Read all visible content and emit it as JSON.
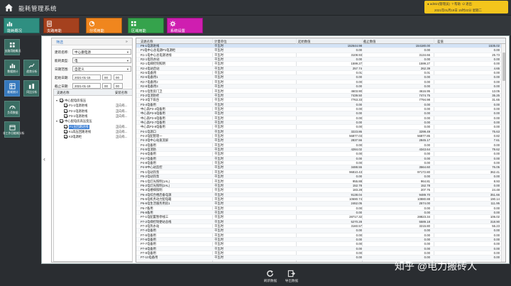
{
  "header": {
    "title": "能耗管理系统",
    "user": "admin(管理员)",
    "help_label": "帮助",
    "exit_label": "退出",
    "datetime": "2021年01月19日 15时22分 星期二"
  },
  "main_tabs": [
    {
      "label": "能耗概况",
      "icon": "chart-icon",
      "color": "#2f8f81"
    },
    {
      "label": "支路用能",
      "icon": "doc-icon",
      "color": "#a5411e"
    },
    {
      "label": "分项用能",
      "icon": "pie-icon",
      "color": "#f0861e"
    },
    {
      "label": "区域用能",
      "icon": "grid-icon",
      "color": "#35a34c"
    },
    {
      "label": "系统设置",
      "icon": "gear-icon",
      "color": "#cf1eb0"
    }
  ],
  "side_nav": [
    {
      "label": "支路用能概况",
      "icon": "grid-icon"
    },
    {
      "label": "数据统计",
      "icon": "bar-icon"
    },
    {
      "label": "趋势分析",
      "icon": "trend-icon"
    },
    {
      "label": "能耗统计",
      "icon": "table-icon"
    },
    {
      "label": "同比分析",
      "icon": "compare-icon"
    },
    {
      "label": "负荷数据",
      "icon": "load-icon"
    },
    {
      "label": "非工作日能耗分析",
      "icon": "calendar-icon"
    }
  ],
  "filter": {
    "title": "筛选",
    "building_label": "建筑名称:",
    "building_value": "中心康电源",
    "energy_label": "能耗类型:",
    "energy_value": "电",
    "period_label": "日期范围:",
    "period_value": "自定义",
    "start_label": "起始日期:",
    "start_date": "2021-01-15",
    "start_h": "00",
    "start_m": "00",
    "end_label": "截止日期:",
    "end_date": "2021-01-19",
    "end_h": "00",
    "end_m": "00"
  },
  "tree": {
    "col_name": "支路名称",
    "col_state": "安装名称",
    "nodes": [
      {
        "label": "中心配电房低压",
        "level": 0,
        "checked": true,
        "state": ""
      },
      {
        "label": "P1-1电源进线",
        "level": 1,
        "checked": true,
        "state": "正向有..."
      },
      {
        "label": "P2-1电源进线",
        "level": 1,
        "checked": true,
        "state": "正向有..."
      },
      {
        "label": "P3-1电源进线",
        "level": 1,
        "checked": true,
        "state": "正向有..."
      },
      {
        "label": "中心配电房高压变压",
        "level": 0,
        "checked": true,
        "state": ""
      },
      {
        "label": "F1主回路进线",
        "level": 1,
        "checked": true,
        "state": "正向有...",
        "selected": true
      },
      {
        "label": "K1高压回路进线",
        "level": 1,
        "checked": true,
        "state": "正向有..."
      },
      {
        "label": "K3电源柜",
        "level": 1,
        "checked": true,
        "state": "正向有..."
      }
    ]
  },
  "grid": {
    "columns": [
      "支路名称",
      "计量单位",
      "起始数值",
      "截止数值",
      "差值"
    ],
    "rows": [
      [
        "P8-1电源进线",
        "千瓦时",
        "152644.98",
        "154180.00",
        "1535.02"
      ],
      [
        "P1电中心总电源P1电源柜",
        "千瓦时",
        "0.00",
        "0.00",
        "0.00"
      ],
      [
        "R1-1电中心总电源进线",
        "千瓦时",
        "3108.93",
        "3134.66",
        "25.73"
      ],
      [
        "R2-1电热水站",
        "千瓦时",
        "0.00",
        "0.00",
        "0.00"
      ],
      [
        "R2-1电梯控制照明",
        "千瓦时",
        "1599.27",
        "1599.27",
        "0.00"
      ],
      [
        "R2-4电站后站",
        "千瓦时",
        "257.74",
        "262.39",
        "4.65"
      ],
      [
        "R2-5电备用",
        "千瓦时",
        "0.01",
        "0.01",
        "0.00"
      ],
      [
        "R2-6电备用1",
        "千瓦时",
        "0.00",
        "0.00",
        "0.00"
      ],
      [
        "R2-7电备用2",
        "千瓦时",
        "0.00",
        "0.00",
        "0.00"
      ],
      [
        "R2-8电备用3",
        "千瓦时",
        "0.00",
        "0.00",
        "0.00"
      ],
      [
        "P3-1电泵房门卫",
        "千瓦时",
        "4603.90",
        "4616.95",
        "13.05"
      ],
      [
        "P3-2电消防栓",
        "千瓦时",
        "7439.50",
        "7474.75",
        "35.25"
      ],
      [
        "P3-3电下雨台",
        "千瓦时",
        "7763.33",
        "7794.98",
        "31.65"
      ],
      [
        "P3-4电备用",
        "千瓦时",
        "0.00",
        "0.00",
        "0.00"
      ],
      [
        "中心高P3-4电备用",
        "千瓦时",
        "0.00",
        "0.00",
        "0.00"
      ],
      [
        "中心高P3-5电备用",
        "千瓦时",
        "0.00",
        "0.00",
        "0.00"
      ],
      [
        "中心高P3-6电备用",
        "千瓦时",
        "0.00",
        "0.00",
        "0.00"
      ],
      [
        "中心高P3-7电备用",
        "千瓦时",
        "0.00",
        "0.00",
        "0.00"
      ],
      [
        "中心高P3-8电备用",
        "千瓦时",
        "0.00",
        "0.00",
        "0.00"
      ],
      [
        "P4-1电源口",
        "千瓦时",
        "3223.86",
        "3299.49",
        "75.63"
      ],
      [
        "P4-2电配管理一",
        "千瓦时",
        "56877.03",
        "56877.85",
        "0.82"
      ],
      [
        "P4-3电中心站直流屏",
        "千瓦时",
        "2837.56",
        "2845.17",
        "7.61"
      ],
      [
        "P4-4电备用",
        "千瓦时",
        "0.00",
        "0.00",
        "0.00"
      ],
      [
        "P4-5电消防",
        "千瓦时",
        "4284.02",
        "4343.64",
        "79.62"
      ],
      [
        "P4-6电备用",
        "千瓦时",
        "0.00",
        "0.00",
        "0.00"
      ],
      [
        "P4-7电备用",
        "千瓦时",
        "0.00",
        "0.00",
        "0.00"
      ],
      [
        "P4-8电备用",
        "千瓦时",
        "0.00",
        "0.00",
        "0.00"
      ],
      [
        "P4-9中心站监控",
        "千瓦时",
        "3488.55",
        "3564.60",
        "76.05"
      ],
      [
        "P5-1电站热泵",
        "千瓦时",
        "96810.43",
        "97172.80",
        "362.41"
      ],
      [
        "P5-2电站热泵",
        "千瓦时",
        "0.00",
        "0.00",
        "0.00"
      ],
      [
        "P6-1电灯光照明(1AL)",
        "千瓦时",
        "955.88",
        "964.81",
        "8.93"
      ],
      [
        "P6-2电灯光照明(2AL)",
        "千瓦时",
        "152.78",
        "152.78",
        "0.00"
      ],
      [
        "P6-3电楼梯照明",
        "千瓦时",
        "183.28",
        "207.76",
        "24.48"
      ],
      [
        "P6-4电综合楼后备电源",
        "千瓦时",
        "9138.04",
        "9489.70",
        "351.66"
      ],
      [
        "P6-5电机务动力配电箱",
        "千瓦时",
        "10690.74",
        "10880.88",
        "190.14"
      ],
      [
        "P6-6电生活服务用房1",
        "千瓦时",
        "2462.05",
        "2574.00",
        "111.95"
      ],
      [
        "P6-7备用",
        "千瓦时",
        "0.00",
        "0.00",
        "0.00"
      ],
      [
        "P6-8备用",
        "千瓦时",
        "0.00",
        "0.00",
        "0.00"
      ],
      [
        "P7-1电配置暂停线三",
        "千瓦时",
        "28717.32",
        "28823.34",
        "106.02"
      ],
      [
        "P7-2电梯控制便站总线",
        "千瓦时",
        "5270.28",
        "5589.18",
        "318.90"
      ],
      [
        "P7-3电热水站",
        "千瓦时",
        "3160.57",
        "3215.80",
        "55.23"
      ],
      [
        "P7-4电备用",
        "千瓦时",
        "0.00",
        "0.00",
        "0.00"
      ],
      [
        "P7-5电备用",
        "千瓦时",
        "0.00",
        "0.00",
        "0.00"
      ],
      [
        "P7-6电备用",
        "千瓦时",
        "0.00",
        "0.00",
        "0.00"
      ],
      [
        "P7-7电备用",
        "千瓦时",
        "0.00",
        "0.00",
        "0.00"
      ],
      [
        "P7-8电备用",
        "千瓦时",
        "0.00",
        "0.00",
        "0.00"
      ],
      [
        "P7-9电备用",
        "千瓦时",
        "0.00",
        "0.00",
        "0.00"
      ],
      [
        "P7-10电备用",
        "千瓦时",
        "0.00",
        "0.00",
        "0.00"
      ]
    ]
  },
  "footer": {
    "refresh_label": "刷新数据",
    "export_label": "导出数据"
  },
  "watermark": "知乎 @电力搬砖人"
}
